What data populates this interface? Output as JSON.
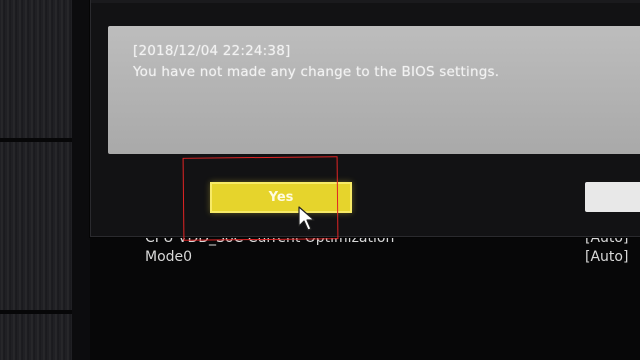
{
  "dialog": {
    "timestamp": "[2018/12/04 22:24:38]",
    "message": "You have not made any change to the BIOS settings.",
    "yes_label": "Yes"
  },
  "settings": [
    {
      "label": "CPU VDD_SoC Current Optimization",
      "value": "[Auto]"
    },
    {
      "label": "Mode0",
      "value": "[Auto]"
    }
  ],
  "colors": {
    "yes_button": "#e6d42c",
    "annotation": "#e02424",
    "message_box": "#b4b4b4"
  }
}
